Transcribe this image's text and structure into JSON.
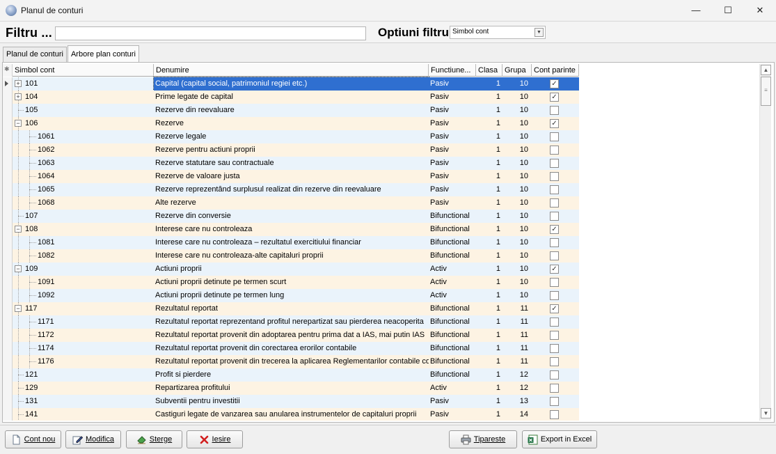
{
  "window": {
    "title": "Planul de conturi",
    "minimize": "—",
    "maximize": "☐",
    "close": "✕"
  },
  "filter": {
    "label": "Filtru ...",
    "value": "",
    "options_label": "Optiuni filtru",
    "option_selected": "Simbol cont"
  },
  "tabs": [
    "Planul de conturi",
    "Arbore plan conturi"
  ],
  "grid": {
    "columns": [
      "Simbol cont",
      "Denumire",
      "Functiune...",
      "Clasa",
      "Grupa",
      "Cont parinte"
    ],
    "rows": [
      {
        "sym": "101",
        "den": "Capital (capital social, patrimoniul regiei etc.)",
        "fun": "Pasiv",
        "cls": "1",
        "grp": "10",
        "par": true,
        "level": 0,
        "exp": "+",
        "sel": true
      },
      {
        "sym": "104",
        "den": "Prime legate de capital",
        "fun": "Pasiv",
        "cls": "1",
        "grp": "10",
        "par": true,
        "level": 0,
        "exp": "+"
      },
      {
        "sym": "105",
        "den": "Rezerve din reevaluare",
        "fun": "Pasiv",
        "cls": "1",
        "grp": "10",
        "par": false,
        "level": 0,
        "exp": ""
      },
      {
        "sym": "106",
        "den": "Rezerve",
        "fun": "Pasiv",
        "cls": "1",
        "grp": "10",
        "par": true,
        "level": 0,
        "exp": "−"
      },
      {
        "sym": "1061",
        "den": "Rezerve legale",
        "fun": "Pasiv",
        "cls": "1",
        "grp": "10",
        "par": false,
        "level": 1,
        "exp": ""
      },
      {
        "sym": "1062",
        "den": "Rezerve pentru actiuni proprii",
        "fun": "Pasiv",
        "cls": "1",
        "grp": "10",
        "par": false,
        "level": 1,
        "exp": ""
      },
      {
        "sym": "1063",
        "den": "Rezerve statutare sau contractuale",
        "fun": "Pasiv",
        "cls": "1",
        "grp": "10",
        "par": false,
        "level": 1,
        "exp": ""
      },
      {
        "sym": "1064",
        "den": "Rezerve de valoare justa",
        "fun": "Pasiv",
        "cls": "1",
        "grp": "10",
        "par": false,
        "level": 1,
        "exp": ""
      },
      {
        "sym": "1065",
        "den": "Rezerve reprezentând surplusul realizat din rezerve din reevaluare",
        "fun": "Pasiv",
        "cls": "1",
        "grp": "10",
        "par": false,
        "level": 1,
        "exp": ""
      },
      {
        "sym": "1068",
        "den": "Alte rezerve",
        "fun": "Pasiv",
        "cls": "1",
        "grp": "10",
        "par": false,
        "level": 1,
        "exp": ""
      },
      {
        "sym": "107",
        "den": "Rezerve din conversie",
        "fun": "Bifunctional",
        "cls": "1",
        "grp": "10",
        "par": false,
        "level": 0,
        "exp": ""
      },
      {
        "sym": "108",
        "den": "Interese care nu controleaza",
        "fun": "Bifunctional",
        "cls": "1",
        "grp": "10",
        "par": true,
        "level": 0,
        "exp": "−"
      },
      {
        "sym": "1081",
        "den": "Interese care nu controleaza – rezultatul exercitiului financiar",
        "fun": "Bifunctional",
        "cls": "1",
        "grp": "10",
        "par": false,
        "level": 1,
        "exp": ""
      },
      {
        "sym": "1082",
        "den": "Interese care nu controleaza-alte capitaluri proprii",
        "fun": "Bifunctional",
        "cls": "1",
        "grp": "10",
        "par": false,
        "level": 1,
        "exp": ""
      },
      {
        "sym": "109",
        "den": "Actiuni proprii",
        "fun": "Activ",
        "cls": "1",
        "grp": "10",
        "par": true,
        "level": 0,
        "exp": "−"
      },
      {
        "sym": "1091",
        "den": "Actiuni proprii detinute pe termen scurt",
        "fun": "Activ",
        "cls": "1",
        "grp": "10",
        "par": false,
        "level": 1,
        "exp": ""
      },
      {
        "sym": "1092",
        "den": "Actiuni proprii  detinute pe termen lung",
        "fun": "Activ",
        "cls": "1",
        "grp": "10",
        "par": false,
        "level": 1,
        "exp": ""
      },
      {
        "sym": "117",
        "den": "Rezultatul reportat",
        "fun": "Bifunctional",
        "cls": "1",
        "grp": "11",
        "par": true,
        "level": 0,
        "exp": "−"
      },
      {
        "sym": "1171",
        "den": "Rezultatul reportat reprezentand profitul nerepartizat sau pierderea neacoperita",
        "fun": "Bifunctional",
        "cls": "1",
        "grp": "11",
        "par": false,
        "level": 1,
        "exp": ""
      },
      {
        "sym": "1172",
        "den": "Rezultatul reportat provenit din adoptarea pentru prima dat a IAS, mai putin IAS",
        "fun": "Bifunctional",
        "cls": "1",
        "grp": "11",
        "par": false,
        "level": 1,
        "exp": ""
      },
      {
        "sym": "1174",
        "den": "Rezultatul reportat provenit din corectarea erorilor contabile",
        "fun": "Bifunctional",
        "cls": "1",
        "grp": "11",
        "par": false,
        "level": 1,
        "exp": ""
      },
      {
        "sym": "1176",
        "den": "Rezultatul reportat provenit din trecerea la aplicarea Reglementarilor contabile co",
        "fun": "Bifunctional",
        "cls": "1",
        "grp": "11",
        "par": false,
        "level": 1,
        "exp": ""
      },
      {
        "sym": "121",
        "den": "Profit si pierdere",
        "fun": "Bifunctional",
        "cls": "1",
        "grp": "12",
        "par": false,
        "level": 0,
        "exp": ""
      },
      {
        "sym": "129",
        "den": "Repartizarea profitului",
        "fun": "Activ",
        "cls": "1",
        "grp": "12",
        "par": false,
        "level": 0,
        "exp": ""
      },
      {
        "sym": "131",
        "den": "Subventii pentru investitii",
        "fun": "Pasiv",
        "cls": "1",
        "grp": "13",
        "par": false,
        "level": 0,
        "exp": ""
      },
      {
        "sym": "141",
        "den": "Castiguri legate de vanzarea sau anularea instrumentelor de capitaluri proprii",
        "fun": "Pasiv",
        "cls": "1",
        "grp": "14",
        "par": false,
        "level": 0,
        "exp": ""
      }
    ]
  },
  "buttons": {
    "new": "Cont nou",
    "edit": "Modifica",
    "delete": "Sterge",
    "exit": "Iesire",
    "print": "Tipareste",
    "excel": "Export in Excel"
  },
  "colors": {
    "row_odd": "#fdf3e3",
    "row_even": "#eaf3fb",
    "selection": "#2f6fd0"
  }
}
